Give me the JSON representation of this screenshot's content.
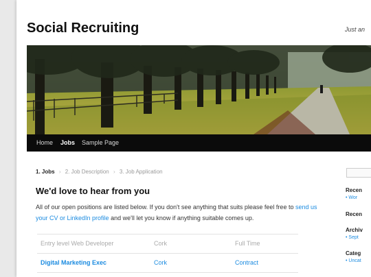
{
  "site": {
    "title": "Social Recruiting",
    "tagline": "Just an"
  },
  "nav": {
    "items": [
      {
        "label": "Home"
      },
      {
        "label": "Jobs"
      },
      {
        "label": "Sample Page"
      }
    ]
  },
  "steps": [
    {
      "label": "1. Jobs"
    },
    {
      "label": "2. Job Description"
    },
    {
      "label": "3. Job Application"
    }
  ],
  "main": {
    "heading": "We'd love to hear from you",
    "intro_text": "All of our open positions are listed below. If you don't see anything that suits please feel free to",
    "intro_link": "send us your CV or LinkedIn profile",
    "intro_tail": "and we'll let you know if anything suitable comes up."
  },
  "jobs": [
    {
      "title": "Entry level Web Developer",
      "location": "Cork",
      "type": "Full Time"
    },
    {
      "title": "Digital Marketing Exec",
      "location": "Cork",
      "type": "Contract"
    }
  ],
  "sidebar": {
    "recent_heading": "Recen",
    "recent_item": "Wor",
    "recent2_heading": "Recen",
    "archives_heading": "Archiv",
    "archives_item": "Sept",
    "categories_heading": "Categ",
    "categories_item": "Uncat"
  },
  "colors": {
    "accent": "#1b8be0",
    "nav_bg": "#0b0b0b",
    "page_bg": "#ffffff"
  }
}
